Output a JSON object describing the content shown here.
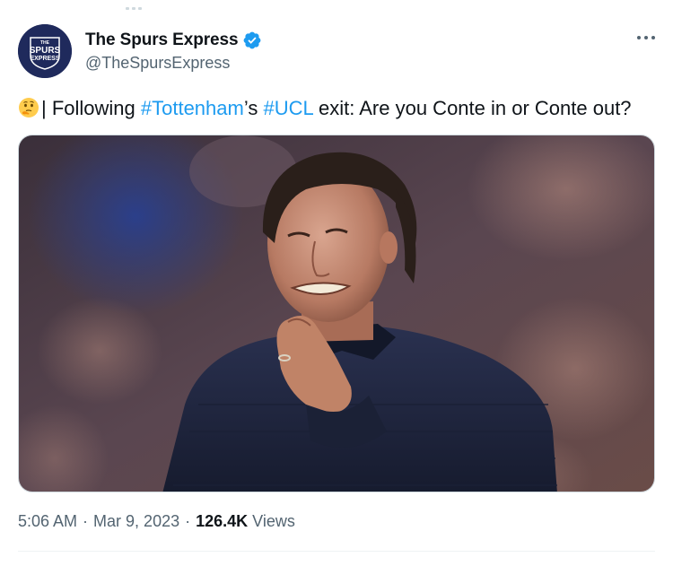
{
  "tweet": {
    "author": {
      "display_name": "The Spurs Express",
      "handle": "@TheSpursExpress",
      "verified": true,
      "avatar_lines": [
        "THE",
        "SPURS",
        "EXPRESS"
      ]
    },
    "more_icon": "more-horizontal-icon",
    "text": {
      "emoji": "thinking-face",
      "prefix": "| Following ",
      "hashtag_1": "#Tottenham",
      "between": "’s ",
      "hashtag_2": "#UCL",
      "suffix": " exit: Are you Conte in or Conte out?"
    },
    "media": {
      "type": "photo"
    },
    "meta": {
      "time": "5:06 AM",
      "date": "Mar 9, 2023",
      "views_count": "126.4K",
      "views_label": "Views",
      "separator": "·"
    },
    "colors": {
      "accent": "#1d9bf0",
      "text_primary": "#0f1419",
      "text_secondary": "#536471",
      "divider": "#eff3f4",
      "avatar_bg": "#1f2a5c"
    }
  }
}
